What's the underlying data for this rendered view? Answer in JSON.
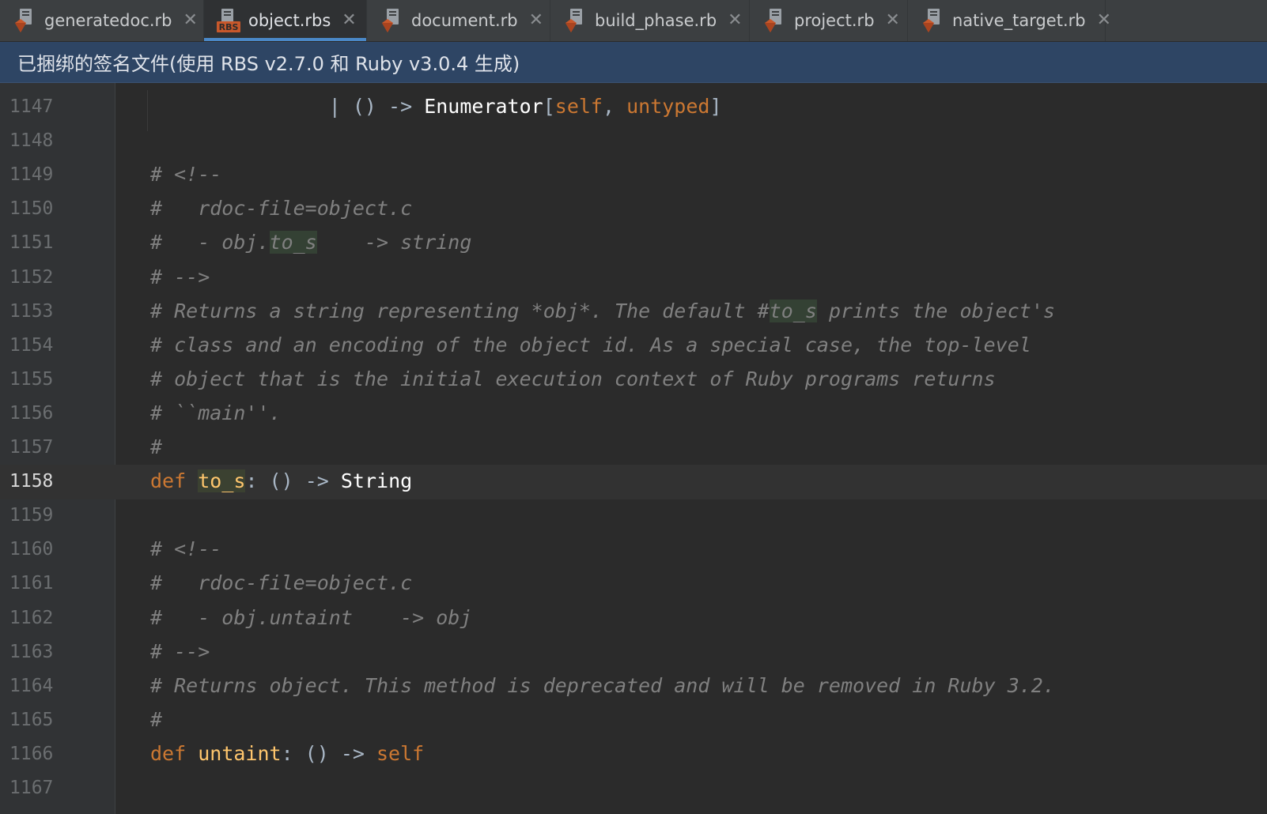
{
  "tabs": [
    {
      "label": "generatedoc.rb",
      "icon": "ruby-file-icon",
      "active": false
    },
    {
      "label": "object.rbs",
      "icon": "rbs-file-icon",
      "active": true
    },
    {
      "label": "document.rb",
      "icon": "ruby-file-icon",
      "active": false
    },
    {
      "label": "build_phase.rb",
      "icon": "ruby-file-icon",
      "active": false
    },
    {
      "label": "project.rb",
      "icon": "ruby-file-icon",
      "active": false
    },
    {
      "label": "native_target.rb",
      "icon": "ruby-file-icon",
      "active": false
    }
  ],
  "tab_close_glyph": "✕",
  "rbs_badge": "RBS",
  "banner": {
    "text": "已捆绑的签名文件(使用 RBS v2.7.0 和 Ruby v3.0.4 生成)"
  },
  "editor": {
    "current_line": 1158,
    "lines": [
      {
        "n": "1147",
        "tokens": [
          {
            "t": "               | () -> ",
            "c": "pl"
          },
          {
            "t": "Enumerator",
            "c": "ty"
          },
          {
            "t": "[",
            "c": "pl"
          },
          {
            "t": "self",
            "c": "kw"
          },
          {
            "t": ", ",
            "c": "pl"
          },
          {
            "t": "untyped",
            "c": "kw"
          },
          {
            "t": "]",
            "c": "pl"
          }
        ]
      },
      {
        "n": "1148",
        "tokens": []
      },
      {
        "n": "1149",
        "tokens": [
          {
            "t": "# <!--",
            "c": "cm"
          }
        ]
      },
      {
        "n": "1150",
        "tokens": [
          {
            "t": "#   rdoc-file=object.c",
            "c": "cm"
          }
        ]
      },
      {
        "n": "1151",
        "tokens": [
          {
            "t": "#   - obj.",
            "c": "cm"
          },
          {
            "t": "to_s",
            "c": "cm hl"
          },
          {
            "t": "    -> string",
            "c": "cm"
          }
        ]
      },
      {
        "n": "1152",
        "tokens": [
          {
            "t": "# -->",
            "c": "cm"
          }
        ]
      },
      {
        "n": "1153",
        "tokens": [
          {
            "t": "# Returns a string representing *obj*. The default #",
            "c": "cm"
          },
          {
            "t": "to_s",
            "c": "cm hl"
          },
          {
            "t": " prints the object's",
            "c": "cm"
          }
        ]
      },
      {
        "n": "1154",
        "tokens": [
          {
            "t": "# class and an encoding of the object id. As a special case, the top-level",
            "c": "cm"
          }
        ]
      },
      {
        "n": "1155",
        "tokens": [
          {
            "t": "# object that is the initial execution context of Ruby programs returns",
            "c": "cm"
          }
        ]
      },
      {
        "n": "1156",
        "tokens": [
          {
            "t": "# ``main''.",
            "c": "cm"
          }
        ]
      },
      {
        "n": "1157",
        "tokens": [
          {
            "t": "#",
            "c": "cm"
          }
        ]
      },
      {
        "n": "1158",
        "tokens": [
          {
            "t": "def",
            "c": "kw"
          },
          {
            "t": " ",
            "c": "pl"
          },
          {
            "t": "to_s",
            "c": "fn hlw"
          },
          {
            "t": ": () -> ",
            "c": "pl"
          },
          {
            "t": "String",
            "c": "ty"
          }
        ]
      },
      {
        "n": "1159",
        "tokens": []
      },
      {
        "n": "1160",
        "tokens": [
          {
            "t": "# <!--",
            "c": "cm"
          }
        ]
      },
      {
        "n": "1161",
        "tokens": [
          {
            "t": "#   rdoc-file=object.c",
            "c": "cm"
          }
        ]
      },
      {
        "n": "1162",
        "tokens": [
          {
            "t": "#   - obj.untaint    -> obj",
            "c": "cm"
          }
        ]
      },
      {
        "n": "1163",
        "tokens": [
          {
            "t": "# -->",
            "c": "cm"
          }
        ]
      },
      {
        "n": "1164",
        "tokens": [
          {
            "t": "# Returns object. This method is deprecated and will be removed in Ruby 3.2.",
            "c": "cm"
          }
        ]
      },
      {
        "n": "1165",
        "tokens": [
          {
            "t": "#",
            "c": "cm"
          }
        ]
      },
      {
        "n": "1166",
        "tokens": [
          {
            "t": "def",
            "c": "kw"
          },
          {
            "t": " ",
            "c": "pl"
          },
          {
            "t": "untaint",
            "c": "fn"
          },
          {
            "t": ": () -> ",
            "c": "pl"
          },
          {
            "t": "self",
            "c": "kw"
          }
        ]
      },
      {
        "n": "1167",
        "tokens": []
      }
    ]
  },
  "colors": {
    "accent": "#4a88c7",
    "banner_bg": "#2e4564",
    "editor_bg": "#2b2b2b",
    "keyword": "#cc7832",
    "function": "#ffc66d",
    "comment": "#808080"
  }
}
